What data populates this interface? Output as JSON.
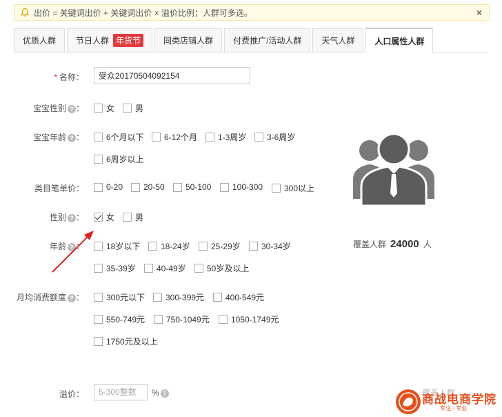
{
  "notice": {
    "text": "出价 = 关键词出价 + 关键词出价 × 溢价比例；人群可多选。",
    "close": "×"
  },
  "tabs": [
    {
      "label": "优质人群"
    },
    {
      "label": "节日人群",
      "badge": "年货节"
    },
    {
      "label": "同类店铺人群"
    },
    {
      "label": "付费推广/活动人群"
    },
    {
      "label": "天气人群"
    },
    {
      "label": "人口属性人群",
      "active": true
    }
  ],
  "form": {
    "name": {
      "label": "名称：",
      "required_mark": "*",
      "value": "受众20170504092154"
    },
    "baby_gender": {
      "label": "宝宝性别",
      "options": [
        "女",
        "男"
      ]
    },
    "baby_age": {
      "label": "宝宝年龄",
      "options": [
        "6个月以下",
        "6-12个月",
        "1-3周岁",
        "3-6周岁",
        "6周岁以上"
      ]
    },
    "category_price": {
      "label": "类目笔单价：",
      "options": [
        "0-20",
        "20-50",
        "50-100",
        "100-300",
        "300以上"
      ]
    },
    "gender": {
      "label": "性别",
      "options": [
        "女",
        "男"
      ],
      "checked": [
        "女"
      ]
    },
    "age": {
      "label": "年龄",
      "options": [
        "18岁以下",
        "18-24岁",
        "25-29岁",
        "30-34岁",
        "35-39岁",
        "40-49岁",
        "50岁及以上"
      ]
    },
    "monthly_spend": {
      "label": "月均消费额度",
      "options": [
        "300元以下",
        "300-399元",
        "400-549元",
        "550-749元",
        "750-1049元",
        "1050-1749元",
        "1750元及以上"
      ]
    },
    "premium": {
      "label": "溢价：",
      "placeholder": "5-300整数",
      "unit": "%"
    }
  },
  "colon": "：",
  "help_glyph": "?",
  "coverage": {
    "label": "覆盖人群",
    "value": "24000",
    "unit": "人"
  },
  "logo": {
    "text": "商战电商学院",
    "sub": "专注 · 专业"
  },
  "faded_text": "覆盖人群"
}
